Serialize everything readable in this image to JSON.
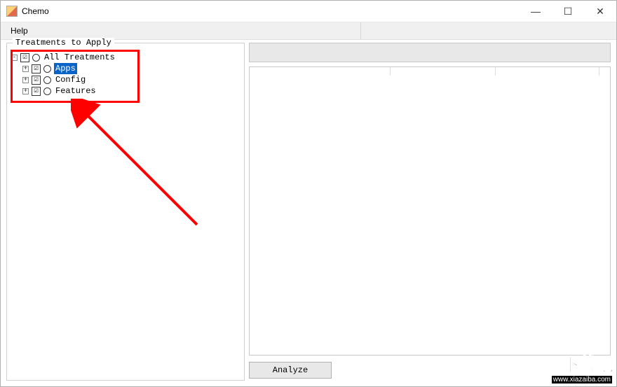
{
  "window": {
    "title": "Chemo",
    "controls": {
      "minimize": "—",
      "maximize": "☐",
      "close": "✕"
    }
  },
  "menu": {
    "help": "Help"
  },
  "groupbox": {
    "caption": "Treatments to Apply"
  },
  "tree": {
    "root": {
      "expander": "-",
      "check": "☑",
      "label": "All Treatments",
      "selected": false
    },
    "children": [
      {
        "expander": "+",
        "check": "☑",
        "label": "Apps",
        "selected": true
      },
      {
        "expander": "+",
        "check": "☑",
        "label": "Config",
        "selected": false
      },
      {
        "expander": "+",
        "check": "☑",
        "label": "Features",
        "selected": false
      }
    ]
  },
  "buttons": {
    "analyze": "Analyze"
  },
  "watermark": {
    "big": "下载吧",
    "small": "www.xiazaiba.com"
  }
}
